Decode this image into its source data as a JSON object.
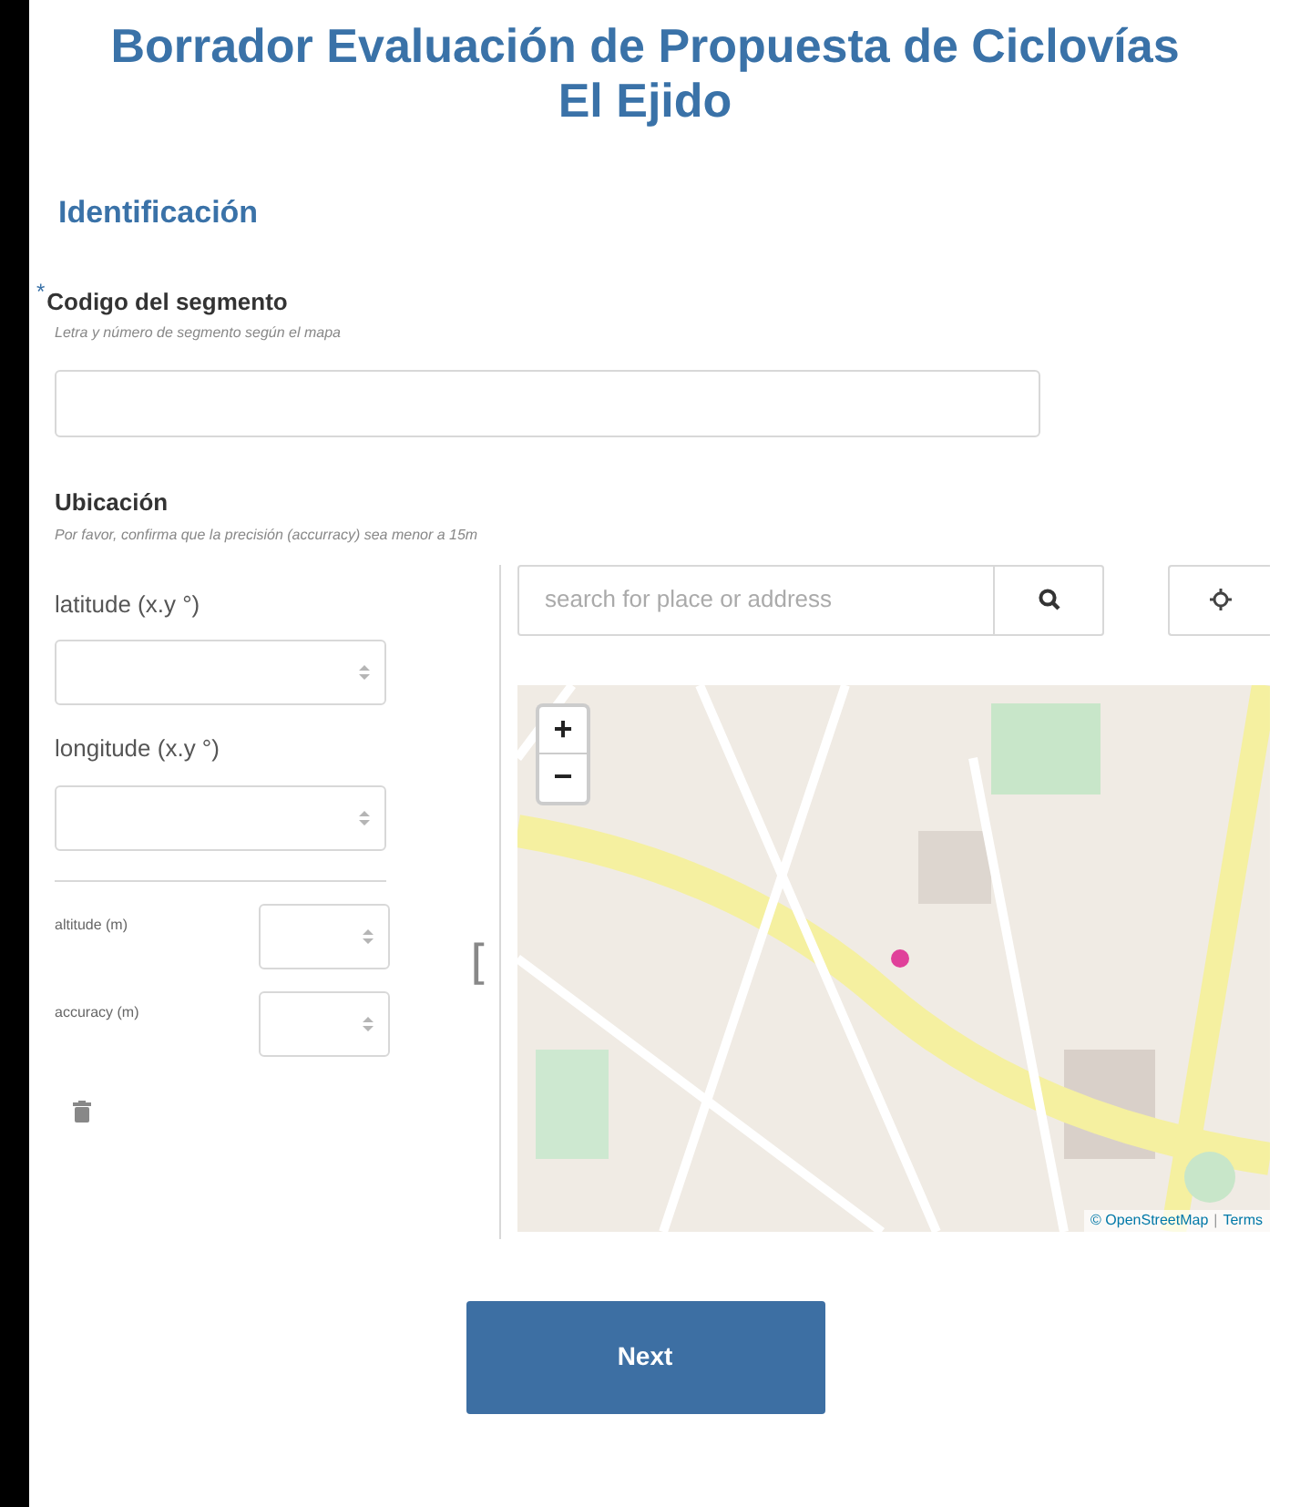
{
  "title": "Borrador Evaluación de Propuesta de Ciclovías El Ejido",
  "section": "Identificación",
  "question": {
    "label": "Codigo del segmento",
    "required": true,
    "required_marker": "*",
    "hint": "Letra y número de segmento según el mapa"
  },
  "location": {
    "label": "Ubicación",
    "hint": "Por favor, confirma que la precisión (accurracy) sea menor a 15m",
    "main_fields": [
      {
        "label": "latitude (x.y °)"
      },
      {
        "label": "longitude (x.y °)"
      }
    ],
    "small_fields": [
      {
        "label": "altitude (m)"
      },
      {
        "label": "accuracy (m)"
      }
    ],
    "handle": "[",
    "search": {
      "placeholder": "search for place or address"
    },
    "map": {
      "kind": "picture",
      "zoom_in": "+",
      "zoom_out": "−",
      "attribution": "© OpenStreetMap",
      "separator": "|",
      "terms": "Terms"
    }
  },
  "next_button": "Next"
}
